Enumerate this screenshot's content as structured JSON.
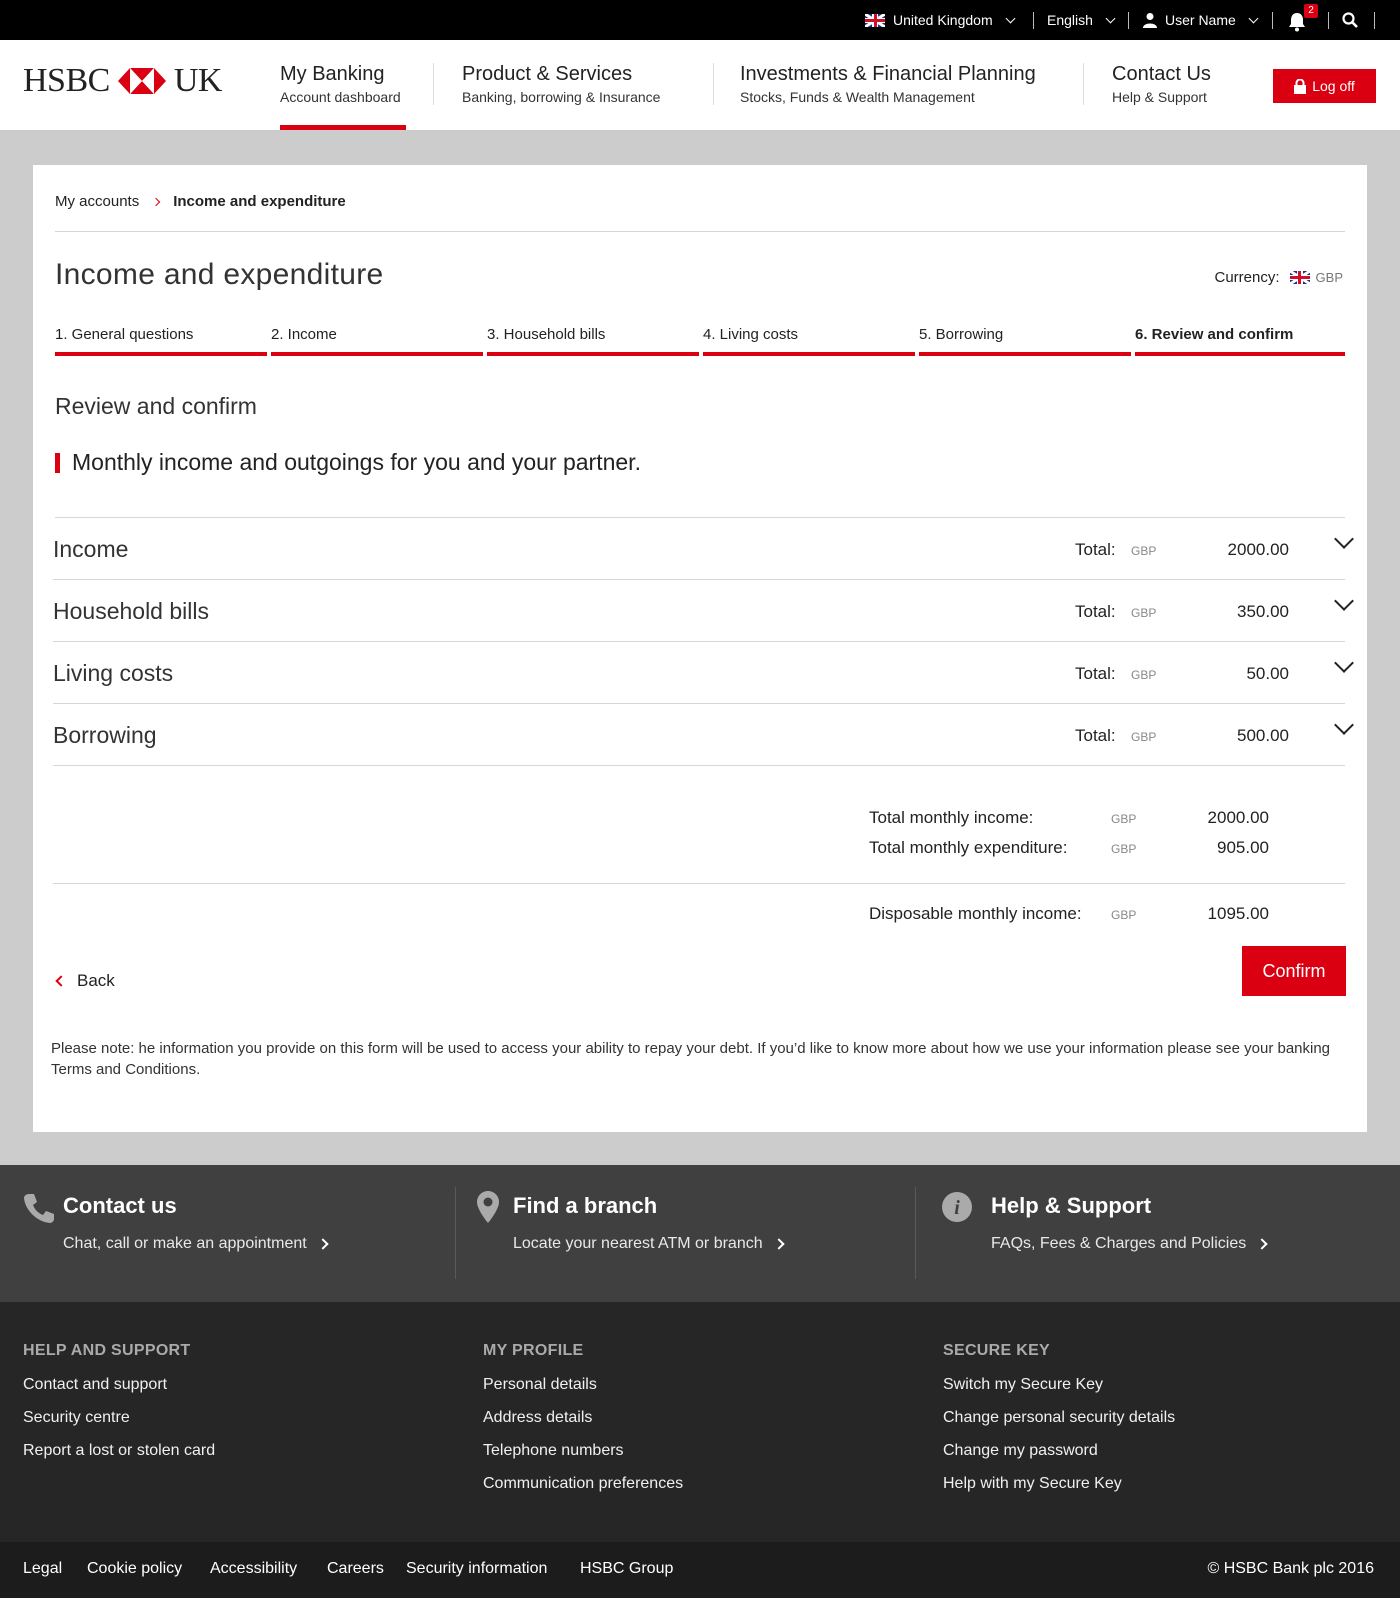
{
  "topbar": {
    "country": "United Kingdom",
    "language": "English",
    "user": "User Name",
    "notifications": "2"
  },
  "brand": {
    "left": "HSBC",
    "right": "UK"
  },
  "nav": [
    {
      "title": "My Banking",
      "subtitle": "Account dashboard"
    },
    {
      "title": "Product & Services",
      "subtitle": "Banking, borrowing & Insurance"
    },
    {
      "title": "Investments & Financial Planning",
      "subtitle": "Stocks, Funds & Wealth Management"
    },
    {
      "title": "Contact Us",
      "subtitle": "Help & Support"
    }
  ],
  "logoff_label": "Log off",
  "breadcrumb": {
    "parent": "My accounts",
    "current": "Income and expenditure"
  },
  "page_title": "Income and expenditure",
  "currency": {
    "label": "Currency:",
    "code": "GBP"
  },
  "steps": [
    "1. General questions",
    "2. Income",
    "3. Household bills",
    "4. Living costs",
    "5. Borrowing",
    "6. Review and confirm"
  ],
  "section_title": "Review and confirm",
  "lead": "Monthly income and outgoings for you and your partner.",
  "categories": [
    {
      "name": "Income",
      "total_label": "Total:",
      "currency": "GBP",
      "value": "2000.00"
    },
    {
      "name": "Household bills",
      "total_label": "Total:",
      "currency": "GBP",
      "value": "350.00"
    },
    {
      "name": "Living costs",
      "total_label": "Total:",
      "currency": "GBP",
      "value": "50.00"
    },
    {
      "name": "Borrowing",
      "total_label": "Total:",
      "currency": "GBP",
      "value": "500.00"
    }
  ],
  "summary": {
    "income_label": "Total monthly income:",
    "income_currency": "GBP",
    "income_value": "2000.00",
    "expenditure_label": "Total monthly expenditure:",
    "expenditure_currency": "GBP",
    "expenditure_value": "905.00",
    "disposable_label": "Disposable monthly income:",
    "disposable_currency": "GBP",
    "disposable_value": "1095.00"
  },
  "actions": {
    "back": "Back",
    "confirm": "Confirm"
  },
  "note": "Please note: he information you provide on this form will be used to access your ability to repay your debt. If you’d like to know more about how we use your information please see your banking Terms and Conditions.",
  "contact_band": [
    {
      "title": "Contact us",
      "sub": "Chat, call or make an appointment"
    },
    {
      "title": "Find a branch",
      "sub": "Locate your nearest ATM or branch"
    },
    {
      "title": "Help & Support",
      "sub": "FAQs, Fees & Charges and Policies"
    }
  ],
  "footer_columns": [
    {
      "heading": "HELP AND SUPPORT",
      "links": [
        "Contact and support",
        "Security centre",
        "Report a lost or stolen card"
      ]
    },
    {
      "heading": "MY PROFILE",
      "links": [
        "Personal details",
        "Address details",
        "Telephone numbers",
        "Communication preferences"
      ]
    },
    {
      "heading": "SECURE KEY",
      "links": [
        "Switch my Secure Key",
        "Change personal security details",
        "Change my password",
        "Help with my Secure Key"
      ]
    }
  ],
  "legal_links": [
    "Legal",
    "Cookie policy",
    "Accessibility",
    "Careers",
    "Security information",
    "HSBC Group"
  ],
  "copyright": "© HSBC Bank plc 2016",
  "colors": {
    "brand_red": "#db0011",
    "topbar": "#000000",
    "footer_band": "#404040",
    "footer_links": "#262626",
    "footer_legal": "#1c1c1c"
  }
}
